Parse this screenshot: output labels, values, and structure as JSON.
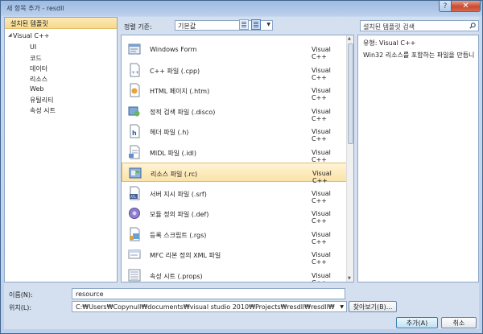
{
  "window": {
    "title": "새 항목 추가 - resdll",
    "help_label": "?",
    "close_label": "✕"
  },
  "left": {
    "header": "설치된 템플릿",
    "root": "Visual C++",
    "children": [
      "UI",
      "코드",
      "데이터",
      "리소스",
      "Web",
      "유틸리티",
      "속성 시트"
    ]
  },
  "toolbar": {
    "sort_label": "정렬 기준:",
    "sort_value": "기본값"
  },
  "search": {
    "placeholder": "설치된 템플릿 검색"
  },
  "templates": [
    {
      "name": "Windows Form",
      "lang": "Visual C++",
      "icon": "windows-form-icon"
    },
    {
      "name": "C++ 파일 (.cpp)",
      "lang": "Visual C++",
      "icon": "cpp-file-icon"
    },
    {
      "name": "HTML 페이지 (.htm)",
      "lang": "Visual C++",
      "icon": "html-page-icon"
    },
    {
      "name": "정적 검색 파일 (.disco)",
      "lang": "Visual C++",
      "icon": "disco-file-icon"
    },
    {
      "name": "헤더 파일 (.h)",
      "lang": "Visual C++",
      "icon": "header-file-icon"
    },
    {
      "name": "MIDL 파일 (.idl)",
      "lang": "Visual C++",
      "icon": "midl-file-icon"
    },
    {
      "name": "리소스 파일 (.rc)",
      "lang": "Visual C++",
      "icon": "resource-file-icon"
    },
    {
      "name": "서버 지시 파일 (.srf)",
      "lang": "Visual C++",
      "icon": "srf-file-icon"
    },
    {
      "name": "모듈 정의 파일 (.def)",
      "lang": "Visual C++",
      "icon": "def-file-icon"
    },
    {
      "name": "등록 스크립트 (.rgs)",
      "lang": "Visual C++",
      "icon": "rgs-file-icon"
    },
    {
      "name": "MFC 리본 정의 XML 파일",
      "lang": "Visual C++",
      "icon": "mfc-ribbon-icon"
    },
    {
      "name": "속성 시트 (.props)",
      "lang": "Visual C++",
      "icon": "props-file-icon"
    }
  ],
  "selected_index": 6,
  "info": {
    "type_label": "유형:",
    "type_value": "Visual C++",
    "description": "Win32 리소스를 포함하는 파일을 만듭니"
  },
  "form": {
    "name_label": "이름(N):",
    "name_value": "resource",
    "location_label": "위치(L):",
    "location_value": "C:₩Users₩Copynull₩documents₩visual studio 2010₩Projects₩resdll₩resdll₩",
    "browse_label": "찾아보기(B)...",
    "add_label": "추가(A)",
    "cancel_label": "취소"
  }
}
